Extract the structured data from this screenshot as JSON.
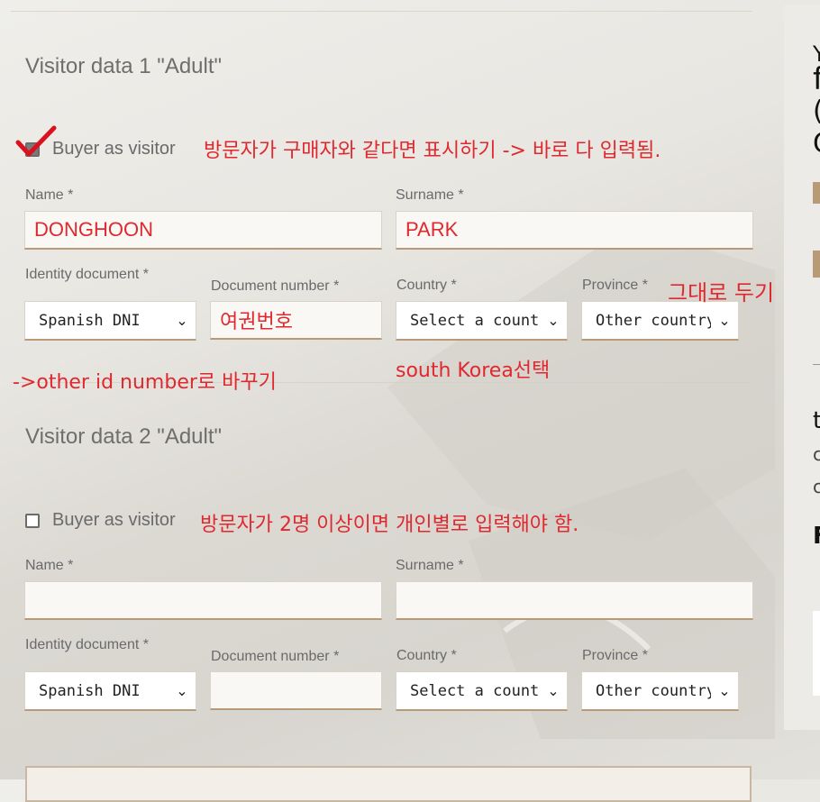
{
  "visitor1": {
    "heading": "Visitor data 1 \"Adult\"",
    "buyer_as_visitor": "Buyer as visitor",
    "checked": true,
    "name_label": "Name *",
    "name_value": "DONGHOON",
    "surname_label": "Surname *",
    "surname_value": "PARK",
    "idoc_label": "Identity document *",
    "idoc_value": "Spanish DNI",
    "docnum_label": "Document number *",
    "docnum_value": "여권번호",
    "country_label": "Country *",
    "country_value": "Select a country",
    "province_label": "Province *",
    "province_value": "Other country"
  },
  "visitor2": {
    "heading": "Visitor data 2 \"Adult\"",
    "buyer_as_visitor": "Buyer as visitor",
    "checked": false,
    "name_label": "Name *",
    "name_value": "",
    "surname_label": "Surname *",
    "surname_value": "",
    "idoc_label": "Identity document *",
    "idoc_value": "Spanish DNI",
    "docnum_label": "Document number *",
    "docnum_value": "",
    "country_label": "Country *",
    "country_value": "Select a country",
    "province_label": "Province *",
    "province_value": "Other country"
  },
  "annotations": {
    "buyer_note": "방문자가 구매자와 같다면 표시하기 -> 바로 다 입력됨.",
    "province_note": "그대로 두기",
    "idoc_note": "->other id number로 바꾸기",
    "country_note": "south Korea선택",
    "visitor2_note": "방문자가 2명 이상이면 개인별로 입력해야 함."
  },
  "right_panel": {
    "line1": "Y",
    "line2": "f",
    "line3": "(",
    "line4": "C",
    "line5": "t",
    "line6": "c",
    "line7": "c",
    "line8": "F"
  },
  "colors": {
    "annotation_red": "#e0282f",
    "field_underline": "#b89a78",
    "check_red": "#d8131f"
  },
  "icons": {
    "dropdown": "chevron-down-icon",
    "annotation_check": "red-checkmark-icon"
  }
}
